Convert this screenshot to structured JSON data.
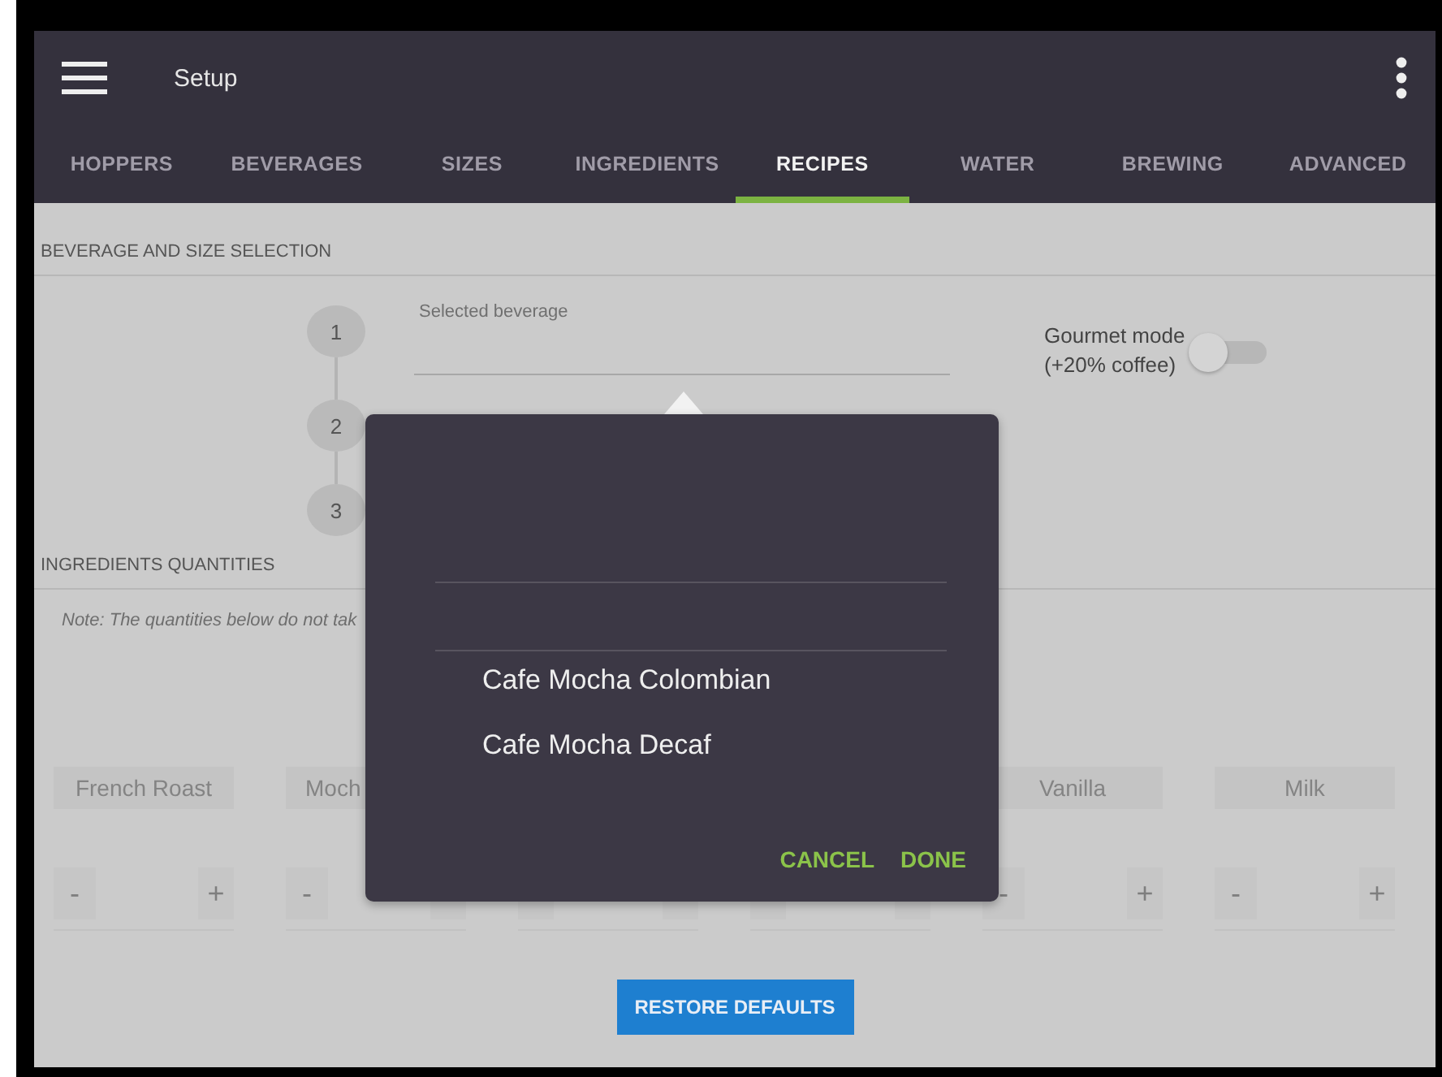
{
  "app_bar": {
    "title": "Setup"
  },
  "tabs": [
    {
      "label": "HOPPERS",
      "selected": false
    },
    {
      "label": "BEVERAGES",
      "selected": false
    },
    {
      "label": "SIZES",
      "selected": false
    },
    {
      "label": "INGREDIENTS",
      "selected": false
    },
    {
      "label": "RECIPES",
      "selected": true
    },
    {
      "label": "WATER",
      "selected": false
    },
    {
      "label": "BREWING",
      "selected": false
    },
    {
      "label": "ADVANCED",
      "selected": false
    }
  ],
  "beverage_section": {
    "heading": "BEVERAGE AND SIZE SELECTION",
    "steps": [
      "1",
      "2",
      "3"
    ],
    "selected_beverage_label": "Selected beverage",
    "gourmet": {
      "label": "Gourmet mode",
      "sublabel": "(+20% coffee)",
      "on": false
    }
  },
  "ingredients_section": {
    "heading": "INGREDIENTS QUANTITIES",
    "note": "Note: The quantities below do not tak",
    "columns": [
      {
        "label": "French Roast",
        "minus": "-",
        "plus": "+"
      },
      {
        "label": "Moch",
        "minus": "-"
      },
      {},
      {},
      {
        "label": "Vanilla",
        "minus": "-",
        "plus": "+"
      },
      {
        "label": "Milk",
        "minus": "-",
        "plus": "+"
      }
    ]
  },
  "restore_button": "RESTORE DEFAULTS",
  "picker_dialog": {
    "options": [
      "Cafe Mocha Colombian",
      "Cafe Mocha Decaf"
    ],
    "buttons": [
      "CANCEL",
      "DONE"
    ]
  }
}
